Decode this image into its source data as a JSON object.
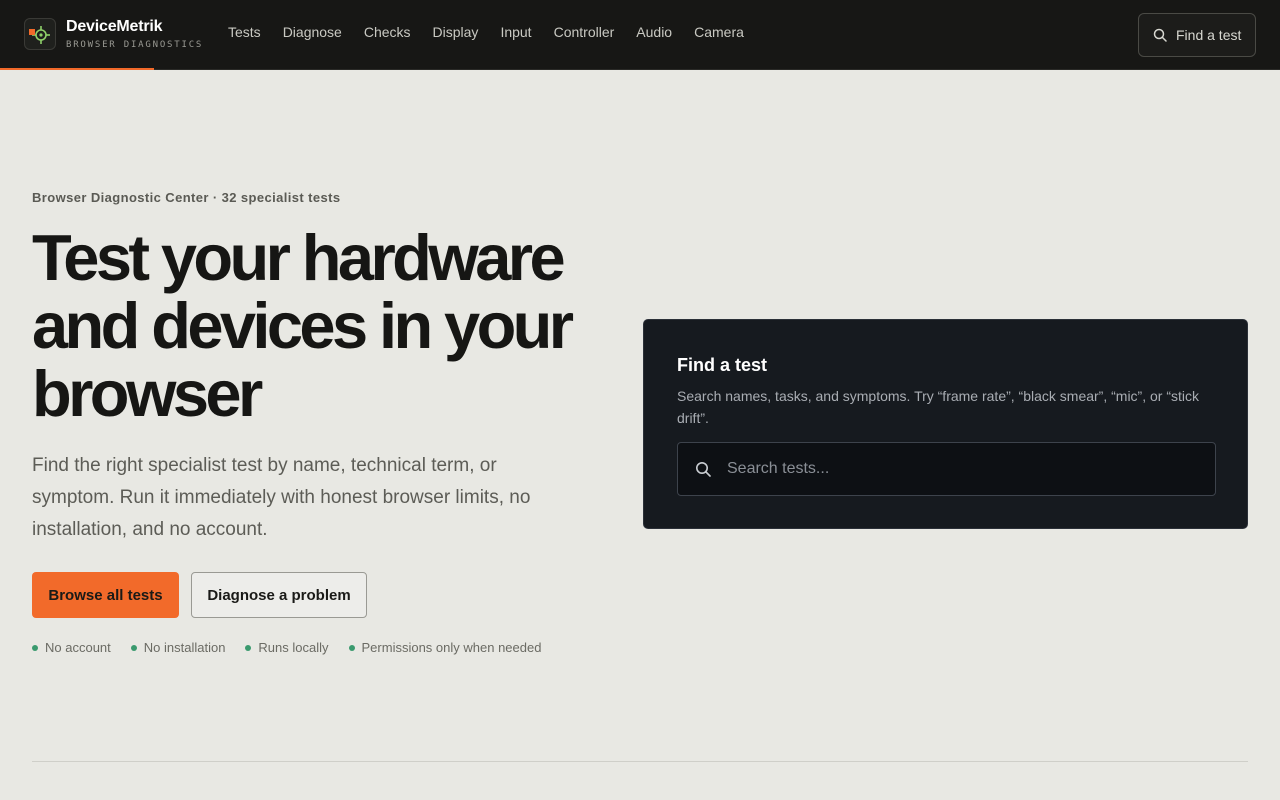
{
  "brand": {
    "name": "DeviceMetrik",
    "tagline": "BROWSER DIAGNOSTICS",
    "accent_color": "#f26a2a"
  },
  "nav": {
    "items": [
      {
        "label": "Tests"
      },
      {
        "label": "Diagnose"
      },
      {
        "label": "Checks"
      },
      {
        "label": "Display"
      },
      {
        "label": "Input"
      },
      {
        "label": "Controller"
      },
      {
        "label": "Audio"
      },
      {
        "label": "Camera"
      }
    ],
    "search_label": "Find a test",
    "search_icon": "search-icon"
  },
  "hero": {
    "eyebrow": "Browser Diagnostic Center · 32 specialist tests",
    "headline": "Test your hardware and devices in your browser",
    "subtext": "Find the right specialist test by name, technical term, or symptom. Run it immediately with honest browser limits, no installation, and no account.",
    "primary_button": "Browse all tests",
    "secondary_button": "Diagnose a problem",
    "features": [
      {
        "label": "No account"
      },
      {
        "label": "No installation"
      },
      {
        "label": "Runs locally"
      },
      {
        "label": "Permissions only when needed"
      }
    ],
    "feature_dot_color": "#3a9a6e"
  },
  "search_card": {
    "title": "Find a test",
    "description": "Search names, tasks, and symptoms. Try “frame rate”, “black smear”, “mic”, or “stick drift”.",
    "input_value": "",
    "placeholder": "Search tests..."
  }
}
